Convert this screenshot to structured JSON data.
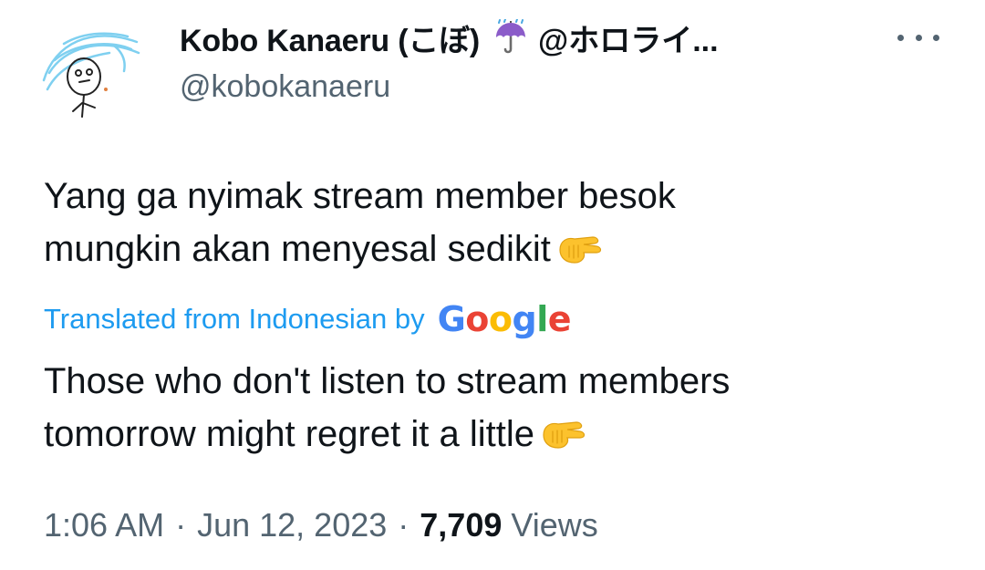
{
  "author": {
    "display_name": "Kobo Kanaeru (こぼ)",
    "badge_icon": "umbrella-rain-icon",
    "name_suffix": "@ホロライ...",
    "handle": "@kobokanaeru"
  },
  "more_icon": "more-options-icon",
  "tweet": {
    "original_lines": [
      "Yang ga nyimak stream member besok",
      "mungkin akan menyesal sedikit"
    ],
    "translation_label": "Translated from Indonesian by",
    "translation_provider": {
      "letters": [
        "G",
        "o",
        "o",
        "g",
        "l",
        "e"
      ],
      "colors": [
        "#4285F4",
        "#EA4335",
        "#FBBC05",
        "#4285F4",
        "#34A853",
        "#EA4335"
      ]
    },
    "translated_lines": [
      "Those who don't listen to stream members",
      "tomorrow might regret it a little"
    ],
    "trailing_emoji": "pinching-hand-emoji"
  },
  "meta": {
    "time": "1:06 AM",
    "separator": "·",
    "date": "Jun 12, 2023",
    "views_count": "7,709",
    "views_label": "Views"
  },
  "colors": {
    "text_primary": "#0f1419",
    "text_secondary": "#536471",
    "link_blue": "#1d9bf0"
  }
}
